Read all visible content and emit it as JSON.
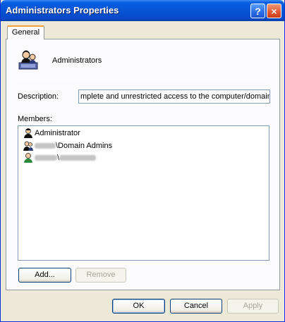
{
  "window": {
    "title": "Administrators Properties",
    "help_label": "?",
    "close_label": "×"
  },
  "tabs": [
    {
      "label": "General",
      "active": true
    }
  ],
  "group": {
    "name": "Administrators",
    "icon": "users-group-icon"
  },
  "description": {
    "label": "Description:",
    "value": "mplete and unrestricted access to the computer/domain"
  },
  "members": {
    "label": "Members:",
    "items": [
      {
        "text": "Administrator",
        "icon": "user-icon"
      },
      {
        "text": "\\Domain Admins",
        "icon": "users-group-icon",
        "redacted_prefix": true
      },
      {
        "text": "\\",
        "icon": "user-icon",
        "redacted_prefix": true,
        "redacted_suffix": true
      }
    ]
  },
  "buttons": {
    "add": "Add...",
    "remove": "Remove",
    "ok": "OK",
    "cancel": "Cancel",
    "apply": "Apply"
  },
  "colors": {
    "titlebar": "#0755d6",
    "dialog_bg": "#ece9d8",
    "tab_accent": "#f3a13a"
  }
}
